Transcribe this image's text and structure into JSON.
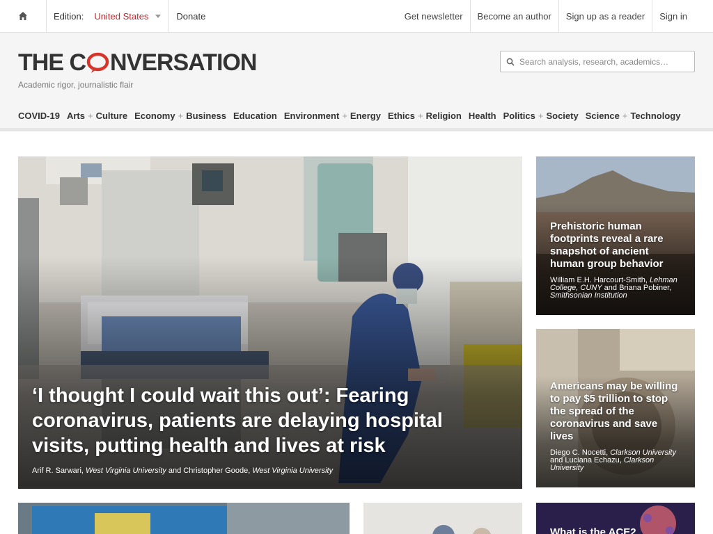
{
  "topbar": {
    "edition_label": "Edition:",
    "edition_value": "United States",
    "donate": "Donate",
    "get_newsletter": "Get newsletter",
    "become_author": "Become an author",
    "sign_up_reader": "Sign up as a reader",
    "sign_in": "Sign in"
  },
  "masthead": {
    "logo_part1": "THE C",
    "logo_part2": "NVERSATION",
    "tagline": "Academic rigor, journalistic flair",
    "search_placeholder": "Search analysis, research, academics…"
  },
  "nav": {
    "covid": "COVID-19",
    "arts": "Arts",
    "culture": "Culture",
    "economy": "Economy",
    "business": "Business",
    "education": "Education",
    "environment": "Environment",
    "energy": "Energy",
    "ethics": "Ethics",
    "religion": "Religion",
    "health": "Health",
    "politics": "Politics",
    "society": "Society",
    "science": "Science",
    "technology": "Technology",
    "plus": "+"
  },
  "hero": {
    "title": "‘I thought I could wait this out’: Fearing coronavirus, patients are delaying hospital visits, putting health and lives at risk",
    "author1": "Arif R. Sarwari",
    "inst1": "West Virginia University",
    "and": "and",
    "author2": "Christopher Goode",
    "inst2": "West Virginia University"
  },
  "side1": {
    "title": "Prehistoric human footprints reveal a rare snapshot of ancient human group behavior",
    "author1": "William E.H. Harcourt-Smith",
    "inst1": "Lehman College, CUNY",
    "and": "and",
    "author2": "Briana Pobiner",
    "inst2": "Smithsonian Institution"
  },
  "side2": {
    "title": "Americans may be willing to pay $5 trillion to stop the spread of the coronavirus and save lives",
    "author1": "Diego C. Nocetti",
    "inst1": "Clarkson University",
    "and": "and",
    "author2": "Luciana Echazu",
    "inst2": "Clarkson University"
  },
  "bot3": {
    "title": "What is the ACE2"
  },
  "colors": {
    "accent": "#c1272d",
    "masthead_bg": "#f5f5f5"
  },
  "icons": {
    "home": "home-icon",
    "search": "search-icon",
    "caret": "chevron-down-icon"
  }
}
